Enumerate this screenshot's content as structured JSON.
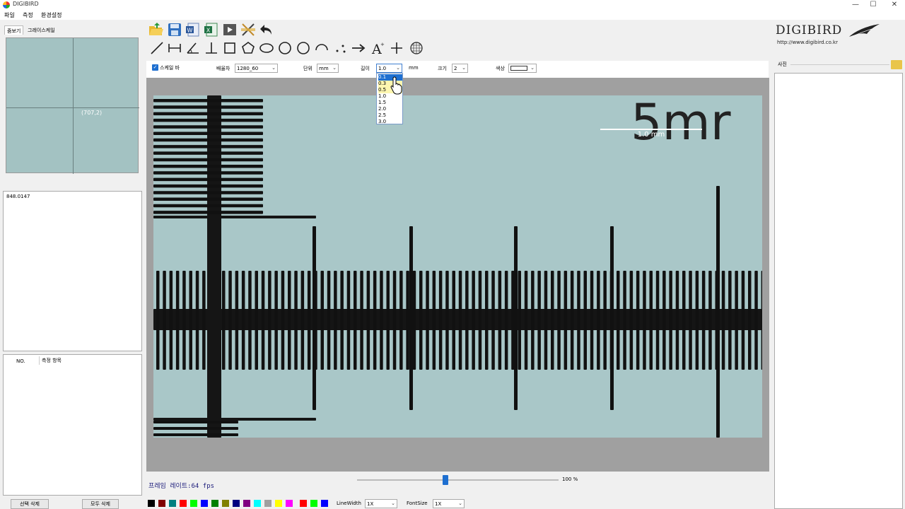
{
  "window": {
    "title": "DIGIBIRD",
    "minimize": "—",
    "maximize": "☐",
    "close": "✕"
  },
  "menu": [
    "파일",
    "측정",
    "환경설정"
  ],
  "left": {
    "tabs": [
      "줌보기",
      "그레이스케일"
    ],
    "coord": "(707,2)",
    "value": "848.0147",
    "list_headers": [
      "NO.",
      "측정 항목"
    ],
    "delete_selected": "선택 삭제",
    "delete_all": "모두 삭제"
  },
  "toolbar": {
    "row1": [
      "open-folder-icon",
      "save-icon",
      "word-export-icon",
      "excel-export-icon",
      "play-icon",
      "measure-tools-icon",
      "undo-icon"
    ],
    "row2": [
      "line-icon",
      "dimension-line-icon",
      "angle-icon",
      "perpendicular-icon",
      "rectangle-icon",
      "pentagon-icon",
      "ellipse-icon",
      "circle-icon",
      "circle-3pt-icon",
      "arc-icon",
      "points-icon",
      "arrow-icon",
      "text-icon",
      "crosshair-icon",
      "grid-circle-icon"
    ]
  },
  "settings": {
    "scale_bar_label": "스케일 바",
    "scale_bar_checked": true,
    "magnification_label": "배율차",
    "magnification_value": "1280_60",
    "unit_label": "단위",
    "unit_value": "mm",
    "length_label": "길이",
    "length_value": "1.0",
    "length_unit": "mm",
    "size_label": "크기",
    "size_value": "2",
    "color_label": "색상",
    "length_options": [
      "0.1",
      "0.3",
      "0.5",
      "1.0",
      "1.5",
      "2.0",
      "2.5",
      "3.0"
    ],
    "length_highlighted": "0.1"
  },
  "image": {
    "scale_bar_text": "1.0 mm",
    "ruler_text": "5mr"
  },
  "bottom": {
    "fps": "프레임 레이트:64 fps",
    "zoom_percent": "100 %",
    "zoom_level": 0.44,
    "linewidth_label": "LineWidth",
    "linewidth_value": "1X",
    "fontsize_label": "FontSize",
    "fontsize_value": "1X",
    "swatches": [
      "#000000",
      "#800000",
      "#008080",
      "#ff0000",
      "#00ff00",
      "#0000ff",
      "#008000",
      "#808000",
      "#000080",
      "#800080",
      "#00ffff",
      "#a0a0a0",
      "#ffff00",
      "#ff00ff",
      "#ff0000",
      "#00ff00",
      "#0000ff"
    ]
  },
  "right": {
    "logo": "DIGIBIRD",
    "url": "http://www.digibird.co.kr",
    "photo_label": "사진"
  }
}
